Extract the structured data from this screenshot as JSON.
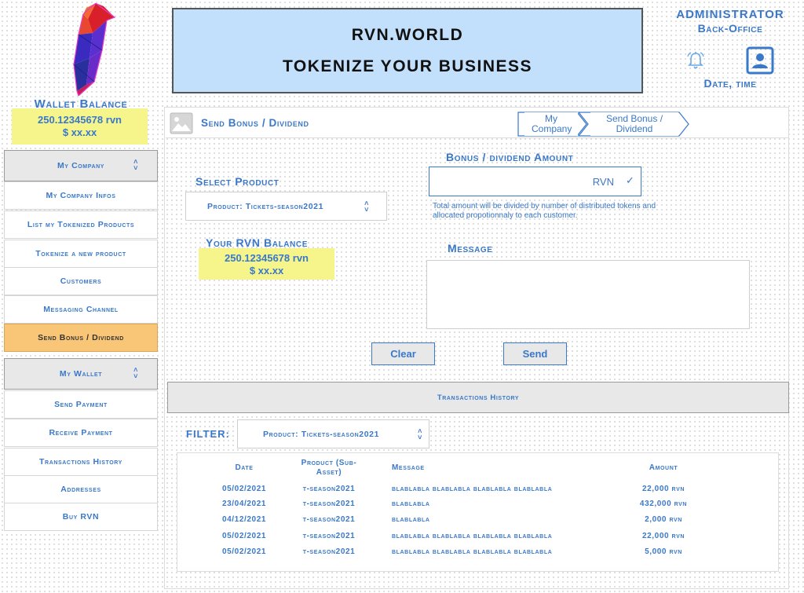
{
  "header": {
    "title_line1": "RVN.WORLD",
    "title_line2": "TOKENIZE YOUR BUSINESS"
  },
  "admin": {
    "title": "ADMINISTRATOR",
    "subtitle": "Back-Office",
    "datetime": "Date, time"
  },
  "wallet": {
    "title": "Wallet Balance",
    "rvn": "250.12345678 rvn",
    "usd": "$ xx.xx"
  },
  "sidebar": {
    "company_header": "My Company",
    "company_items": [
      {
        "label": "My Company Infos"
      },
      {
        "label": "List my Tokenized Products"
      },
      {
        "label": "Tokenize a new product"
      },
      {
        "label": "Customers"
      },
      {
        "label": "Messaging Channel"
      },
      {
        "label": "Send Bonus / Dividend"
      }
    ],
    "wallet_header": "My Wallet",
    "wallet_items": [
      {
        "label": "Send Payment"
      },
      {
        "label": "Receive Payment"
      },
      {
        "label": "Transactions History"
      },
      {
        "label": "Addresses"
      },
      {
        "label": "Buy RVN"
      }
    ]
  },
  "page": {
    "title": "Send Bonus / Dividend",
    "breadcrumb": [
      "My Company",
      "Send Bonus / Dividend"
    ]
  },
  "form": {
    "select_product_label": "Select Product",
    "select_product_value": "Product: Tickets-season2021",
    "balance_label": "Your RVN Balance",
    "balance_rvn": "250.12345678 rvn",
    "balance_usd": "$ xx.xx",
    "amount_label": "Bonus / dividend Amount",
    "amount_unit": "RVN",
    "amount_help": "Total amount will be divided by number of distributed tokens and allocated propotionnaly to each customer.",
    "message_label": "Message",
    "clear_label": "Clear",
    "send_label": "Send"
  },
  "history": {
    "header": "Transactions History",
    "filter_label": "FILTER:",
    "filter_value": "Product: Tickets-season2021",
    "columns": [
      "Date",
      "Product (Sub-Asset)",
      "Message",
      "Amount"
    ],
    "rows": [
      {
        "date": "05/02/2021",
        "product": "t-season2021",
        "message": "blablabla blablabla blablabla blablabla",
        "amount": "22,000 rvn"
      },
      {
        "date": "23/04/2021",
        "product": "t-season2021",
        "message": "blablabla",
        "amount": "432,000 rvn"
      },
      {
        "date": "04/12/2021",
        "product": "t-season2021",
        "message": "blablabla",
        "amount": "2,000 rvn"
      },
      {
        "date": "05/02/2021",
        "product": "t-season2021",
        "message": "blablabla blablabla blablabla blablabla",
        "amount": "22,000 rvn"
      },
      {
        "date": "05/02/2021",
        "product": "t-season2021",
        "message": "blablabla blablabla blablabla blablabla",
        "amount": "5,000 rvn"
      }
    ]
  },
  "icons": {
    "logo": "raven-logo-icon",
    "bell": "bell-icon",
    "profile": "profile-icon",
    "image": "image-placeholder-icon"
  },
  "colors": {
    "accent": "#3a78c9",
    "banner_bg": "#c2dffc",
    "highlight_yellow": "#f5f58c",
    "active_item": "#f8c676"
  }
}
